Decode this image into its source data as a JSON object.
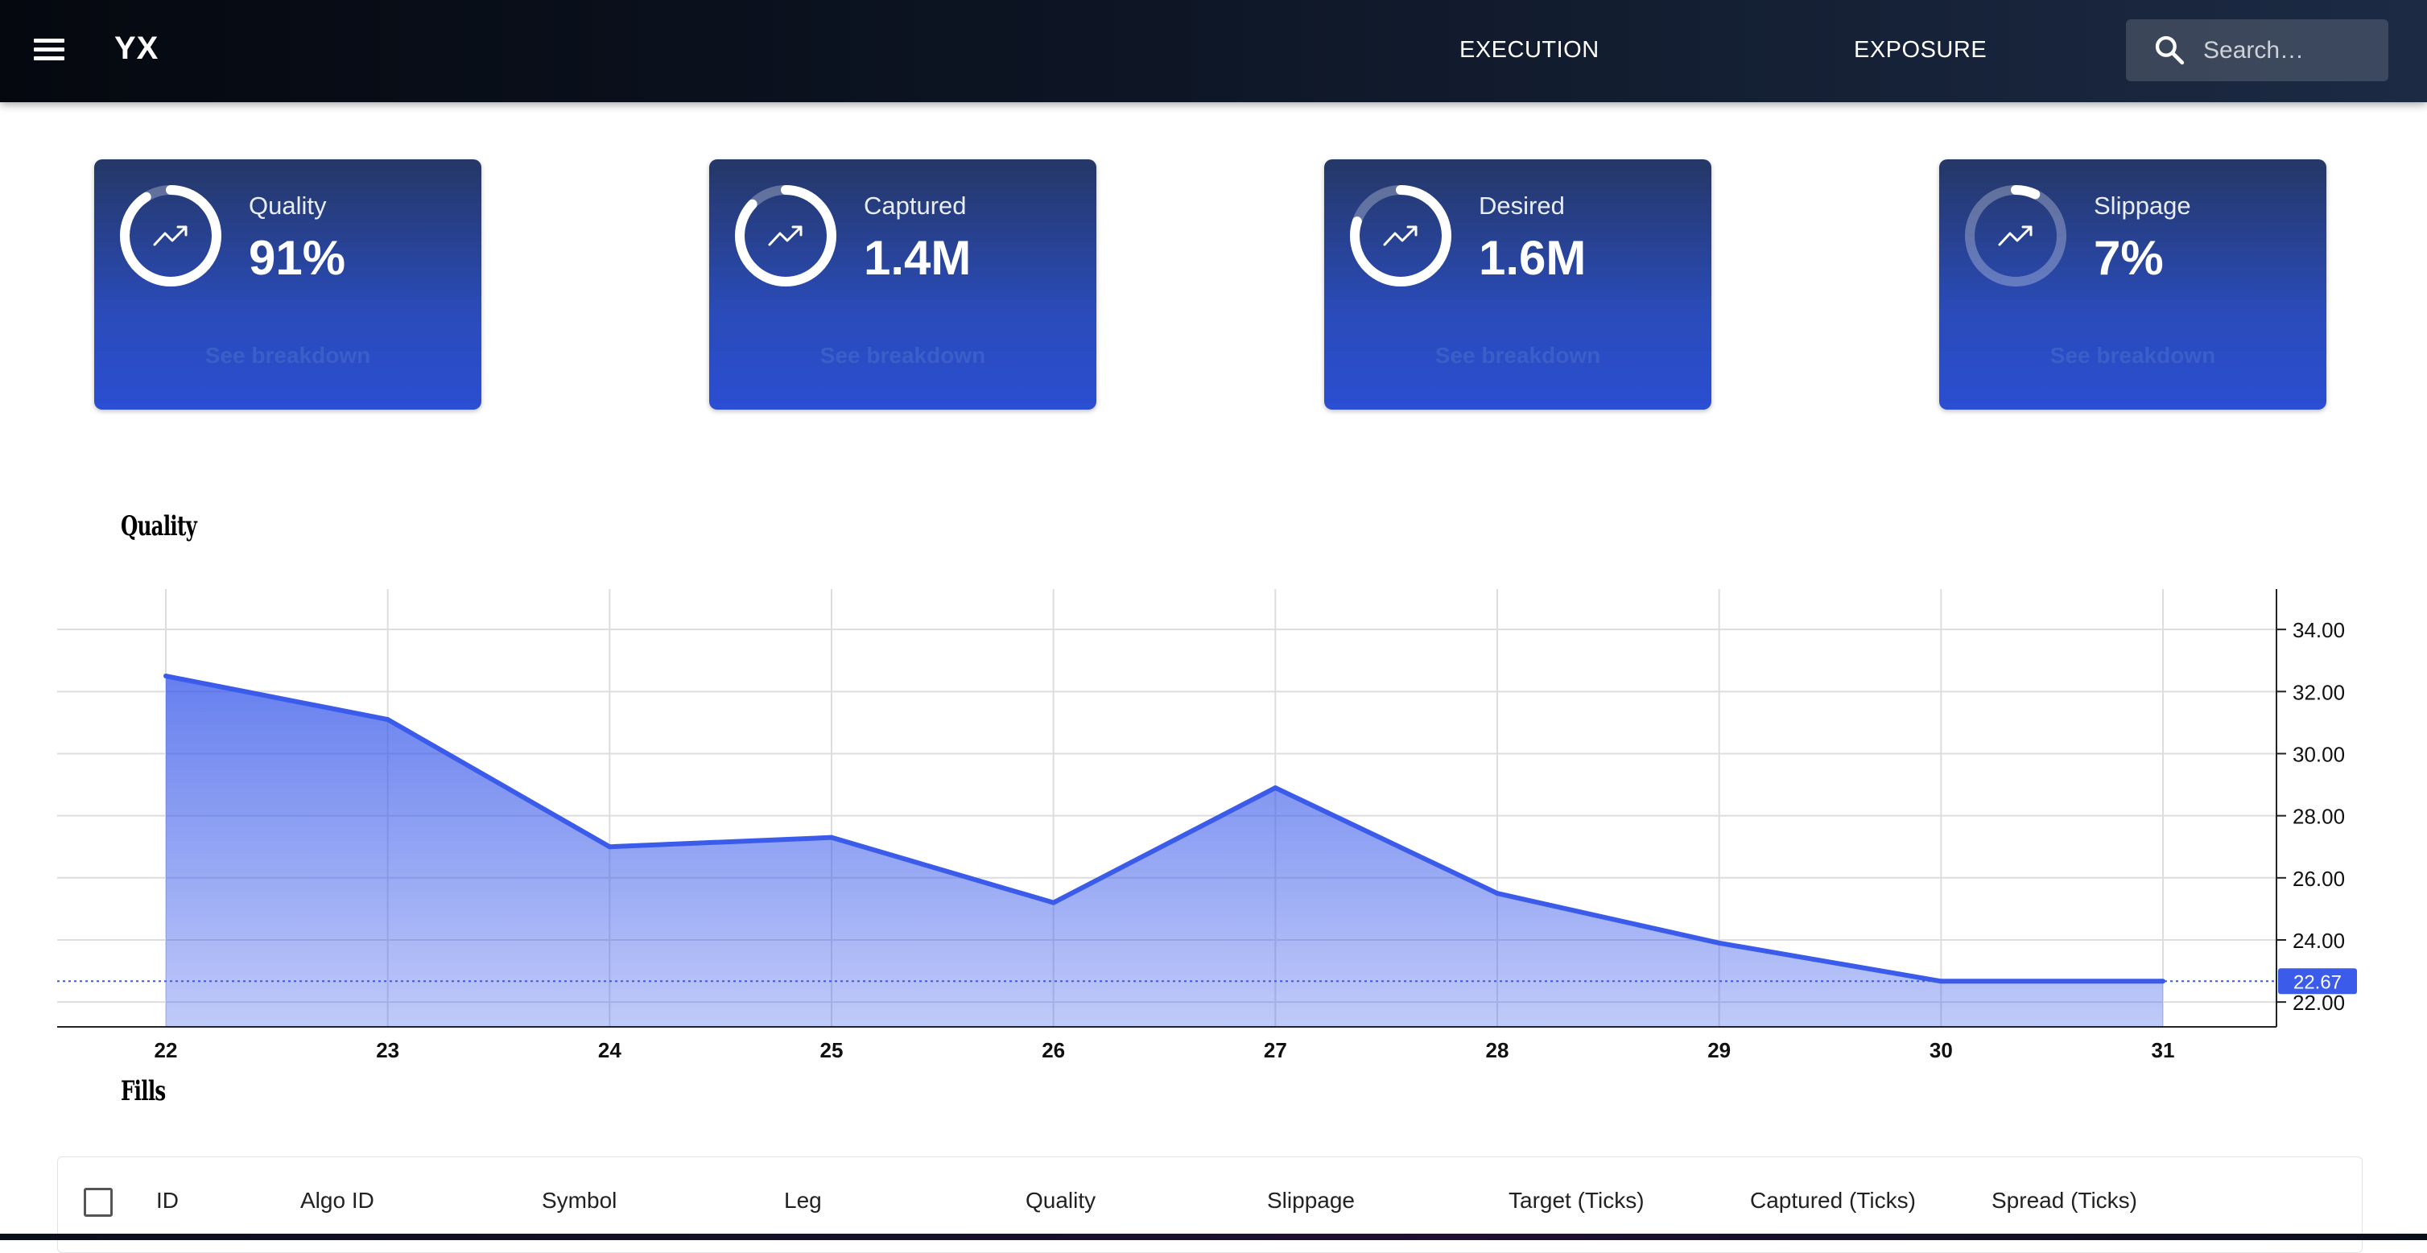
{
  "app": {
    "brand": "YX"
  },
  "nav": {
    "items": [
      {
        "label": "EXECUTION"
      },
      {
        "label": "EXPOSURE"
      }
    ]
  },
  "search": {
    "placeholder": "Search…"
  },
  "cards": [
    {
      "label": "Quality",
      "value": "91%",
      "link": "See breakdown",
      "progress": 0.91,
      "icon": "trending-up-icon"
    },
    {
      "label": "Captured",
      "value": "1.4M",
      "link": "See breakdown",
      "progress": 0.87,
      "icon": "trending-up-icon"
    },
    {
      "label": "Desired",
      "value": "1.6M",
      "link": "See breakdown",
      "progress": 0.8,
      "icon": "trending-up-icon"
    },
    {
      "label": "Slippage",
      "value": "7%",
      "link": "See breakdown",
      "progress": 0.07,
      "icon": "trending-up-icon"
    }
  ],
  "sections": {
    "quality_title": "Quality",
    "fills_title": "Fills"
  },
  "chart_data": {
    "type": "area",
    "x": [
      22,
      23,
      24,
      25,
      26,
      27,
      28,
      29,
      30,
      31
    ],
    "series": [
      {
        "values": [
          32.5,
          31.1,
          27.0,
          27.3,
          25.2,
          28.9,
          25.5,
          23.9,
          22.67,
          22.67
        ]
      }
    ],
    "ylim": [
      21.2,
      35.3
    ],
    "yticks": [
      "34.00",
      "32.00",
      "30.00",
      "28.00",
      "26.00",
      "24.00",
      "22.00"
    ],
    "last_value_label": "22.67",
    "grid": true,
    "y_axis_side": "right",
    "color": "#3b5bea"
  },
  "table": {
    "columns": [
      "ID",
      "Algo ID",
      "Symbol",
      "Leg",
      "Quality",
      "Slippage",
      "Target (Ticks)",
      "Captured (Ticks)",
      "Spread (Ticks)"
    ]
  },
  "colors": {
    "accent": "#3b5bea",
    "card_top": "#253766",
    "card_bottom": "#2b4ed3",
    "topbar": "#0d1524"
  }
}
